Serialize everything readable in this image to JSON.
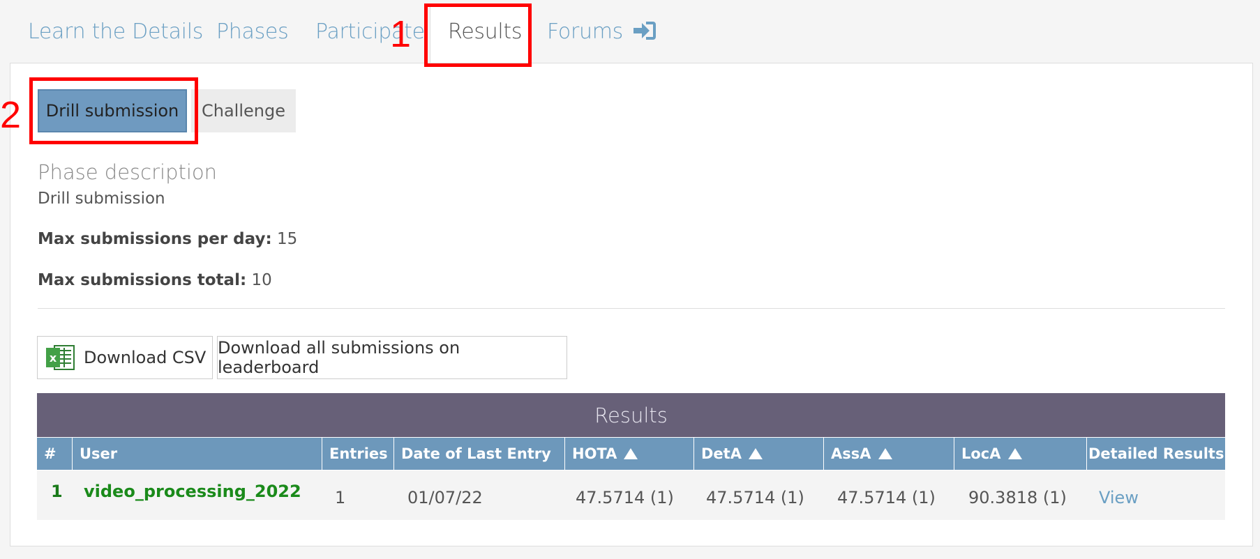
{
  "nav": {
    "tabs": [
      "Learn the Details",
      "Phases",
      "Participate",
      "Results",
      "Forums"
    ],
    "active_tab": "Results"
  },
  "annotations": [
    "1",
    "2"
  ],
  "phases": {
    "buttons": [
      "Drill submission",
      "Challenge"
    ],
    "active": "Drill submission"
  },
  "phase_info": {
    "title": "Phase description",
    "description": "Drill submission",
    "max_per_day_label": "Max submissions per day:",
    "max_per_day_value": "15",
    "max_total_label": "Max submissions total:",
    "max_total_value": "10"
  },
  "downloads": {
    "csv_label": "Download CSV",
    "all_label": "Download all submissions on leaderboard"
  },
  "results_table": {
    "title": "Results",
    "columns": [
      "#",
      "User",
      "Entries",
      "Date of Last Entry",
      "HOTA",
      "DetA",
      "AssA",
      "LocA",
      "Detailed Results"
    ],
    "rows": [
      {
        "rank": "1",
        "user": "video_processing_2022",
        "entries": "1",
        "date": "01/07/22",
        "hota": "47.5714 (1)",
        "deta": "47.5714 (1)",
        "assa": "47.5714 (1)",
        "loca": "90.3818 (1)",
        "detail": "View"
      }
    ]
  },
  "colors": {
    "link": "#6a9fc3",
    "annotation": "#ff0000",
    "table_title_bg": "#676078",
    "table_header_bg": "#6d98bb",
    "rank_green": "#1a8a1a"
  }
}
